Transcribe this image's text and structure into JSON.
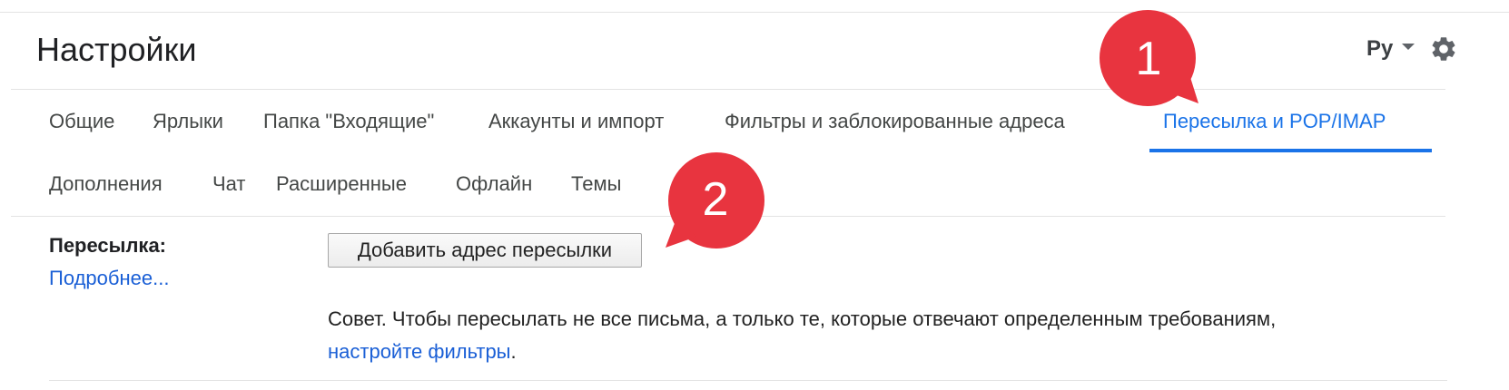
{
  "header": {
    "title": "Настройки",
    "language": "Ру"
  },
  "tabs": [
    {
      "label": "Общие",
      "active": false
    },
    {
      "label": "Ярлыки",
      "active": false
    },
    {
      "label": "Папка \"Входящие\"",
      "active": false
    },
    {
      "label": "Аккаунты и импорт",
      "active": false
    },
    {
      "label": "Фильтры и заблокированные адреса",
      "active": false
    },
    {
      "label": "Пересылка и POP/IMAP",
      "active": true
    },
    {
      "label": "Дополнения",
      "active": false
    },
    {
      "label": "Чат",
      "active": false
    },
    {
      "label": "Расширенные",
      "active": false
    },
    {
      "label": "Офлайн",
      "active": false
    },
    {
      "label": "Темы",
      "active": false
    }
  ],
  "forwarding": {
    "label": "Пересылка:",
    "learn_more": "Подробнее...",
    "add_button": "Добавить адрес пересылки",
    "tip_text": "Совет. Чтобы пересылать не все письма, а только те, которые отвечают определенным требованиям,",
    "tip_link": "настройте фильтры",
    "tip_end": "."
  },
  "annotations": [
    {
      "number": "1"
    },
    {
      "number": "2"
    }
  ],
  "colors": {
    "accent": "#1a73e8",
    "link": "#1a5fd6",
    "annotation": "#e8343f"
  },
  "icons": {
    "settings": "gear-icon",
    "language_dropdown": "caret-down-icon"
  }
}
